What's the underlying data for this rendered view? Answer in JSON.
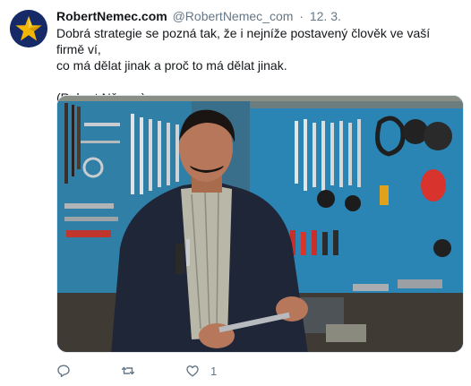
{
  "tweet": {
    "display_name": "RobertNemec.com",
    "handle": "@RobertNemec_com",
    "separator": "·",
    "time": "12. 3.",
    "text_line1": "Dobrá strategie se pozná tak, že i nejníže postavený člověk ve vaší firmě ví,",
    "text_line2": "co má dělat jinak a proč to má dělat jinak.",
    "text_line3": "(Robert Němec)",
    "image": "photo of a mechanic in a workshop with tools hanging on a blue wall"
  },
  "actions": {
    "reply_icon": "reply-icon",
    "retweet_icon": "retweet-icon",
    "like_icon": "heart-icon",
    "like_count": "1"
  },
  "colors": {
    "accent": "#1da1f2",
    "muted": "#657786",
    "avatar_bg": "#162a68",
    "star": "#f2b705"
  }
}
